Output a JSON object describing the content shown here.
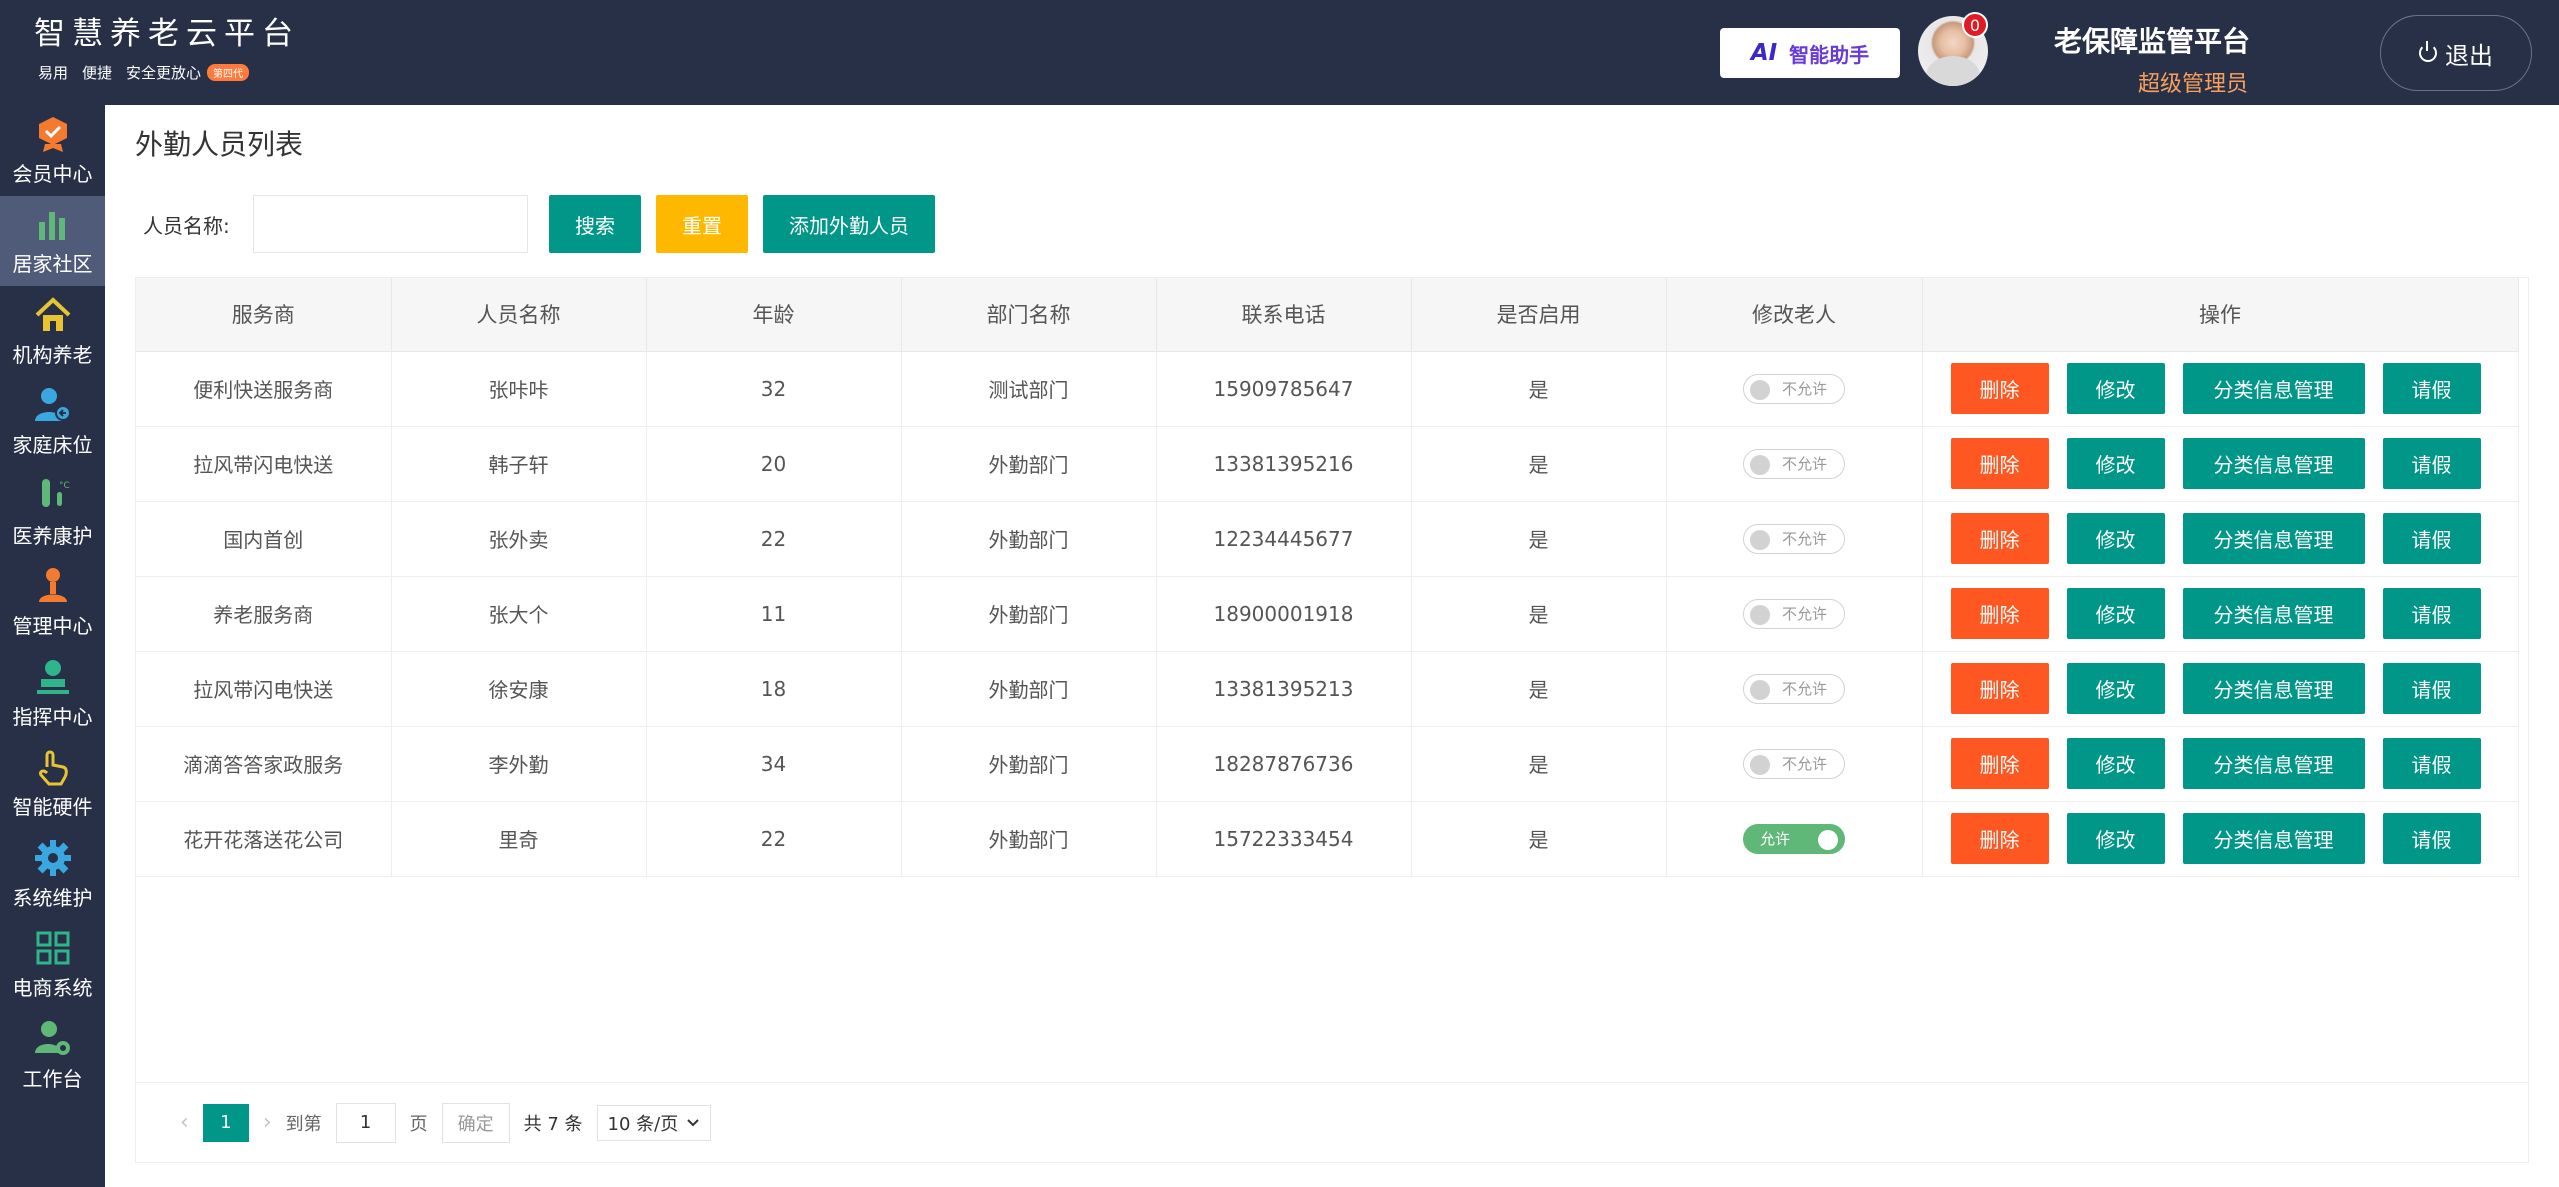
{
  "brand": {
    "title": "智慧养老云平台",
    "tags": [
      "易用",
      "便捷",
      "安全更放心"
    ],
    "badge": "第四代"
  },
  "header": {
    "ai_tag": "AI",
    "ai_label": "智能助手",
    "notification_count": "0",
    "platform_name": "老保障监管平台",
    "role": "超级管理员",
    "logout_label": "退出"
  },
  "sidebar": {
    "items": [
      {
        "label": "会员中心",
        "icon": "member-badge-icon",
        "color": "#f47a2f"
      },
      {
        "label": "居家社区",
        "icon": "bar-chart-icon",
        "color": "#5fb878"
      },
      {
        "label": "机构养老",
        "icon": "home-icon",
        "color": "#e7c531"
      },
      {
        "label": "家庭床位",
        "icon": "user-bed-icon",
        "color": "#3aa7e0"
      },
      {
        "label": "医养康护",
        "icon": "test-tube-icon",
        "color": "#5fb878"
      },
      {
        "label": "管理中心",
        "icon": "manager-icon",
        "color": "#f47a2f"
      },
      {
        "label": "指挥中心",
        "icon": "stamp-icon",
        "color": "#2fb58a"
      },
      {
        "label": "智能硬件",
        "icon": "touch-icon",
        "color": "#e7c531"
      },
      {
        "label": "系统维护",
        "icon": "gear-icon",
        "color": "#3aa7e0"
      },
      {
        "label": "电商系统",
        "icon": "grid-icon",
        "color": "#2fb58a"
      },
      {
        "label": "工作台",
        "icon": "user-gear-icon",
        "color": "#5fb878"
      }
    ],
    "active_index": 1
  },
  "main": {
    "title": "外勤人员列表",
    "search": {
      "label": "人员名称:",
      "value": "",
      "placeholder": "",
      "search_btn": "搜索",
      "reset_btn": "重置",
      "add_btn": "添加外勤人员"
    },
    "table": {
      "columns": [
        "服务商",
        "人员名称",
        "年龄",
        "部门名称",
        "联系电话",
        "是否启用",
        "修改老人",
        "操作"
      ],
      "rows": [
        {
          "provider": "便利快送服务商",
          "name": "张咔咔",
          "age": "32",
          "dept": "测试部门",
          "phone": "15909785647",
          "enabled": "是",
          "modify": "不允许",
          "on": false
        },
        {
          "provider": "拉风带闪电快送",
          "name": "韩子轩",
          "age": "20",
          "dept": "外勤部门",
          "phone": "13381395216",
          "enabled": "是",
          "modify": "不允许",
          "on": false
        },
        {
          "provider": "国内首创",
          "name": "张外卖",
          "age": "22",
          "dept": "外勤部门",
          "phone": "12234445677",
          "enabled": "是",
          "modify": "不允许",
          "on": false
        },
        {
          "provider": "养老服务商",
          "name": "张大个",
          "age": "11",
          "dept": "外勤部门",
          "phone": "18900001918",
          "enabled": "是",
          "modify": "不允许",
          "on": false
        },
        {
          "provider": "拉风带闪电快送",
          "name": "徐安康",
          "age": "18",
          "dept": "外勤部门",
          "phone": "13381395213",
          "enabled": "是",
          "modify": "不允许",
          "on": false
        },
        {
          "provider": "滴滴答答家政服务",
          "name": "李外勤",
          "age": "34",
          "dept": "外勤部门",
          "phone": "18287876736",
          "enabled": "是",
          "modify": "不允许",
          "on": false
        },
        {
          "provider": "花开花落送花公司",
          "name": "里奇",
          "age": "22",
          "dept": "外勤部门",
          "phone": "15722333454",
          "enabled": "是",
          "modify": "允许",
          "on": true
        }
      ],
      "actions": {
        "delete": "删除",
        "edit": "修改",
        "category": "分类信息管理",
        "leave": "请假"
      }
    },
    "pager": {
      "current": "1",
      "goto_label": "到第",
      "goto_value": "1",
      "page_unit": "页",
      "confirm": "确定",
      "total": "共 7 条",
      "size": "10 条/页"
    }
  }
}
